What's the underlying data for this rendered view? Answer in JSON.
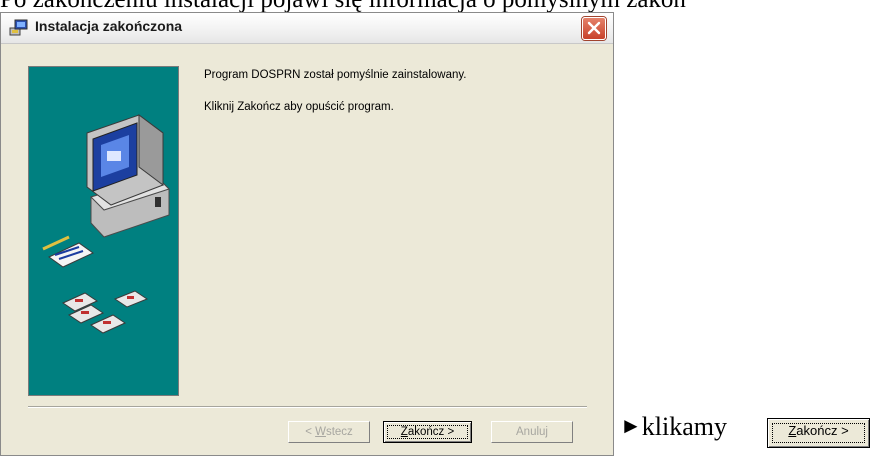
{
  "doc_text": {
    "top_line": "Po zakończeniu instalacji pojawi się informacja o pomyślnym zakoń",
    "hint_text": "klikamy"
  },
  "window": {
    "title": "Instalacja zakończona",
    "close_icon": "close-icon",
    "app_icon": "installer-icon"
  },
  "content": {
    "message1": "Program DOSPRN został pomyślnie zainstalowany.",
    "message2": "Kliknij Zakończ aby opuścić program.",
    "panel_color": "#008080"
  },
  "buttons": {
    "back": {
      "prefix": "< ",
      "mnemonic": "W",
      "rest": "stecz",
      "enabled": false
    },
    "finish": {
      "mnemonic": "Z",
      "rest": "akończ >",
      "enabled": true
    },
    "cancel": {
      "label": "Anuluj",
      "enabled": false
    }
  },
  "hint_button": {
    "mnemonic": "Z",
    "rest": "akończ >"
  }
}
